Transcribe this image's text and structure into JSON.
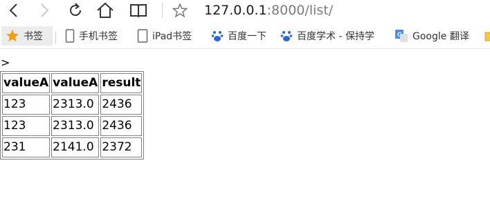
{
  "toolbar": {
    "url_host": "127.0.0.1",
    "url_rest": ":8000/list/"
  },
  "bookmarks": [
    {
      "label": "书签",
      "icon": "star-icon"
    },
    {
      "label": "手机书签",
      "icon": "phone-icon"
    },
    {
      "label": "iPad书签",
      "icon": "tablet-icon"
    },
    {
      "label": "百度一下",
      "icon": "baidu-paw-icon"
    },
    {
      "label": "百度学术 - 保持学",
      "icon": "baidu-paw-icon"
    },
    {
      "label": "Google 翻译",
      "icon": "google-translate-icon"
    }
  ],
  "page": {
    "caret": ">",
    "table": {
      "headers": [
        "valueA",
        "valueA",
        "result"
      ],
      "rows": [
        [
          "123",
          "2313.0",
          "2436"
        ],
        [
          "123",
          "2313.0",
          "2436"
        ],
        [
          "231",
          "2141.0",
          "2372"
        ]
      ]
    }
  }
}
